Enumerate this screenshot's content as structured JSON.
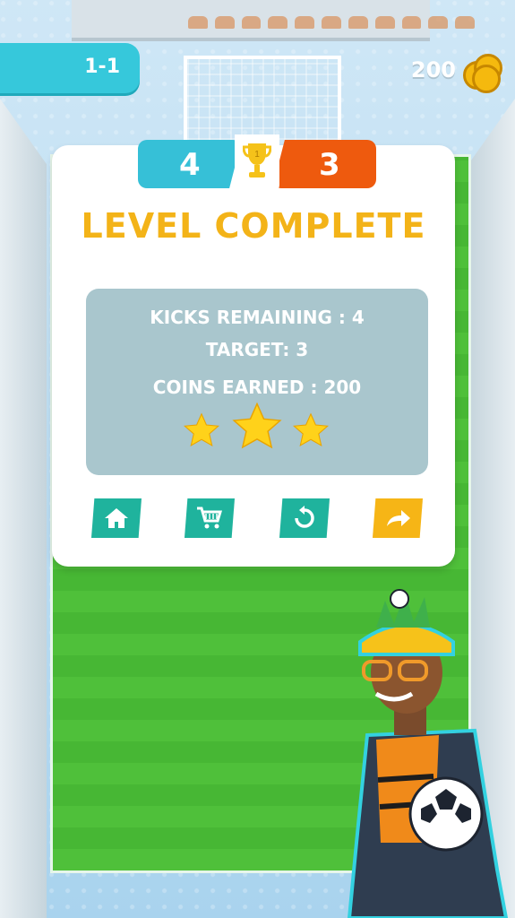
{
  "hud": {
    "level": "1-1",
    "coins": "200"
  },
  "score": {
    "player": "4",
    "opponent": "3",
    "trophy_rank": "1"
  },
  "result": {
    "title": "LEVEL COMPLETE",
    "kicks_remaining": "KICKS REMAINING : 4",
    "target": "TARGET: 3",
    "coins_earned": "COINS EARNED : 200",
    "stars": 3
  },
  "buttons": [
    {
      "name": "home",
      "icon": "home-icon"
    },
    {
      "name": "shop",
      "icon": "cart-icon"
    },
    {
      "name": "retry",
      "icon": "retry-icon"
    },
    {
      "name": "next",
      "icon": "arrow-right-icon"
    }
  ],
  "colors": {
    "accent_teal": "#36c8db",
    "accent_orange": "#ee5a0e",
    "title_yellow": "#f3b318",
    "button_teal": "#1fb39d",
    "button_yellow": "#f6b516"
  }
}
